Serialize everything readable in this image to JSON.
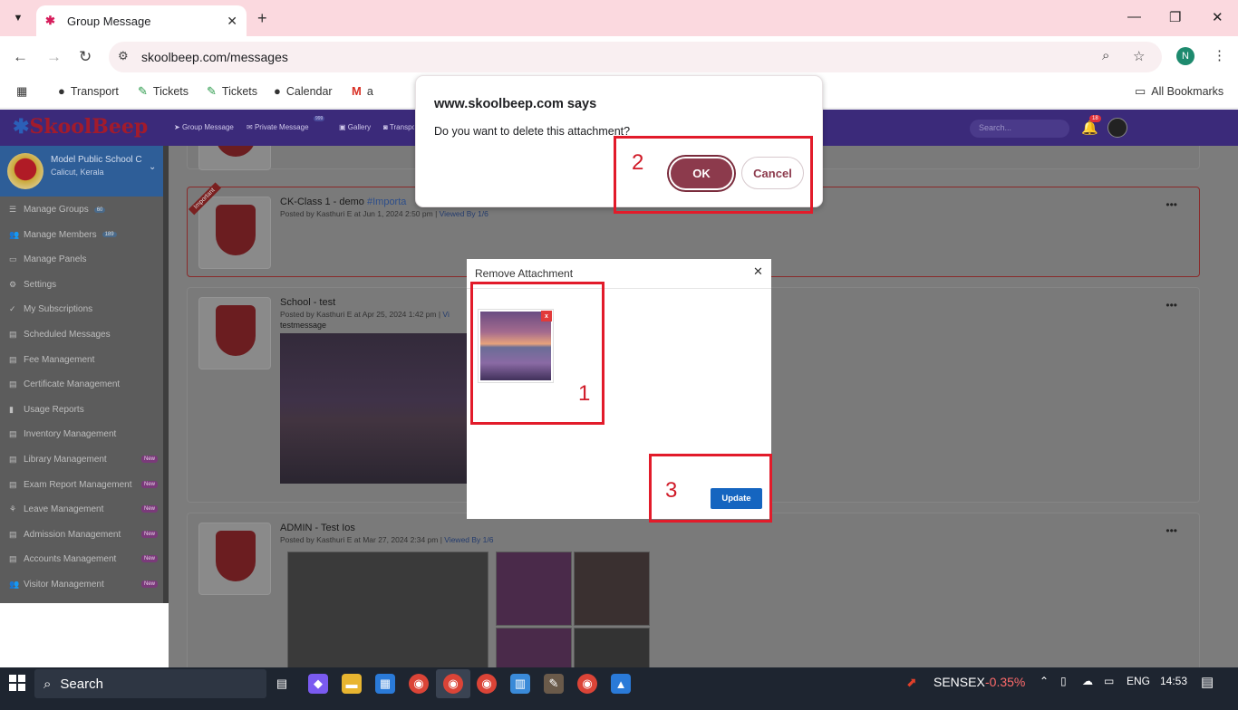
{
  "browser": {
    "tab_title": "Group Message",
    "url": "skoolbeep.com/messages",
    "profile_initial": "N",
    "bookmarks": [
      "Transport",
      "Tickets",
      "Tickets",
      "Calendar",
      "a"
    ],
    "all_bookmarks": "All Bookmarks"
  },
  "app": {
    "logo": "SkoolBeep",
    "nav": [
      "Group Message",
      "Private Message",
      "Gallery",
      "Transport"
    ],
    "nav_badge": "999",
    "search_placeholder": "Search...",
    "bell_count": "18",
    "school_name": "Model Public School C",
    "school_location": "Calicut, Kerala"
  },
  "sidebar": {
    "items": [
      {
        "label": "Manage Groups",
        "count": "60",
        "new": ""
      },
      {
        "label": "Manage Members",
        "count": "189",
        "new": ""
      },
      {
        "label": "Manage Panels",
        "count": "",
        "new": ""
      },
      {
        "label": "Settings",
        "count": "",
        "new": ""
      },
      {
        "label": "My Subscriptions",
        "count": "",
        "new": ""
      },
      {
        "label": "Scheduled Messages",
        "count": "",
        "new": ""
      },
      {
        "label": "Fee Management",
        "count": "",
        "new": ""
      },
      {
        "label": "Certificate Management",
        "count": "",
        "new": ""
      },
      {
        "label": "Usage Reports",
        "count": "",
        "new": ""
      },
      {
        "label": "Inventory Management",
        "count": "",
        "new": ""
      },
      {
        "label": "Library Management",
        "count": "",
        "new": "New"
      },
      {
        "label": "Exam Report Management",
        "count": "",
        "new": "New"
      },
      {
        "label": "Leave Management",
        "count": "",
        "new": "New"
      },
      {
        "label": "Admission Management",
        "count": "",
        "new": "New"
      },
      {
        "label": "Accounts Management",
        "count": "",
        "new": "New"
      },
      {
        "label": "Visitor Management",
        "count": "",
        "new": "New"
      }
    ]
  },
  "posts": [
    {
      "title": "CK-Class 1 - demo",
      "tag": "#Importa",
      "meta": "Posted by Kasthuri E at Jun 1, 2024 2:50 pm",
      "viewed": "Viewed By 1/6",
      "ribbon": "Important",
      "body": ""
    },
    {
      "title": "School - test",
      "tag": "",
      "meta": "Posted by Kasthuri E at Apr 25, 2024 1:42 pm",
      "viewed": "Vi",
      "ribbon": "",
      "body": "testmessage"
    },
    {
      "title": "ADMIN - Test Ios",
      "tag": "",
      "meta": "Posted by Kasthuri E at Mar 27, 2024 2:34 pm",
      "viewed": "Viewed By 1/6",
      "ribbon": "",
      "body": ""
    }
  ],
  "modal": {
    "title": "Remove Attachment",
    "remove_x": "x",
    "update_label": "Update"
  },
  "dialog": {
    "title": "www.skoolbeep.com says",
    "message": "Do you want to delete this attachment?",
    "ok_label": "OK",
    "cancel_label": "Cancel"
  },
  "annotations": [
    "1",
    "2",
    "3"
  ],
  "taskbar": {
    "search_label": "Search",
    "sensex_label": "SENSEX",
    "sensex_value": "-0.35%",
    "language": "ENG",
    "time": "14:53"
  },
  "colors": {
    "tab_strip": "#fbd9df",
    "ok_button": "#8c3a4c",
    "update_button": "#1565c0",
    "annotation": "#e21b2a"
  }
}
